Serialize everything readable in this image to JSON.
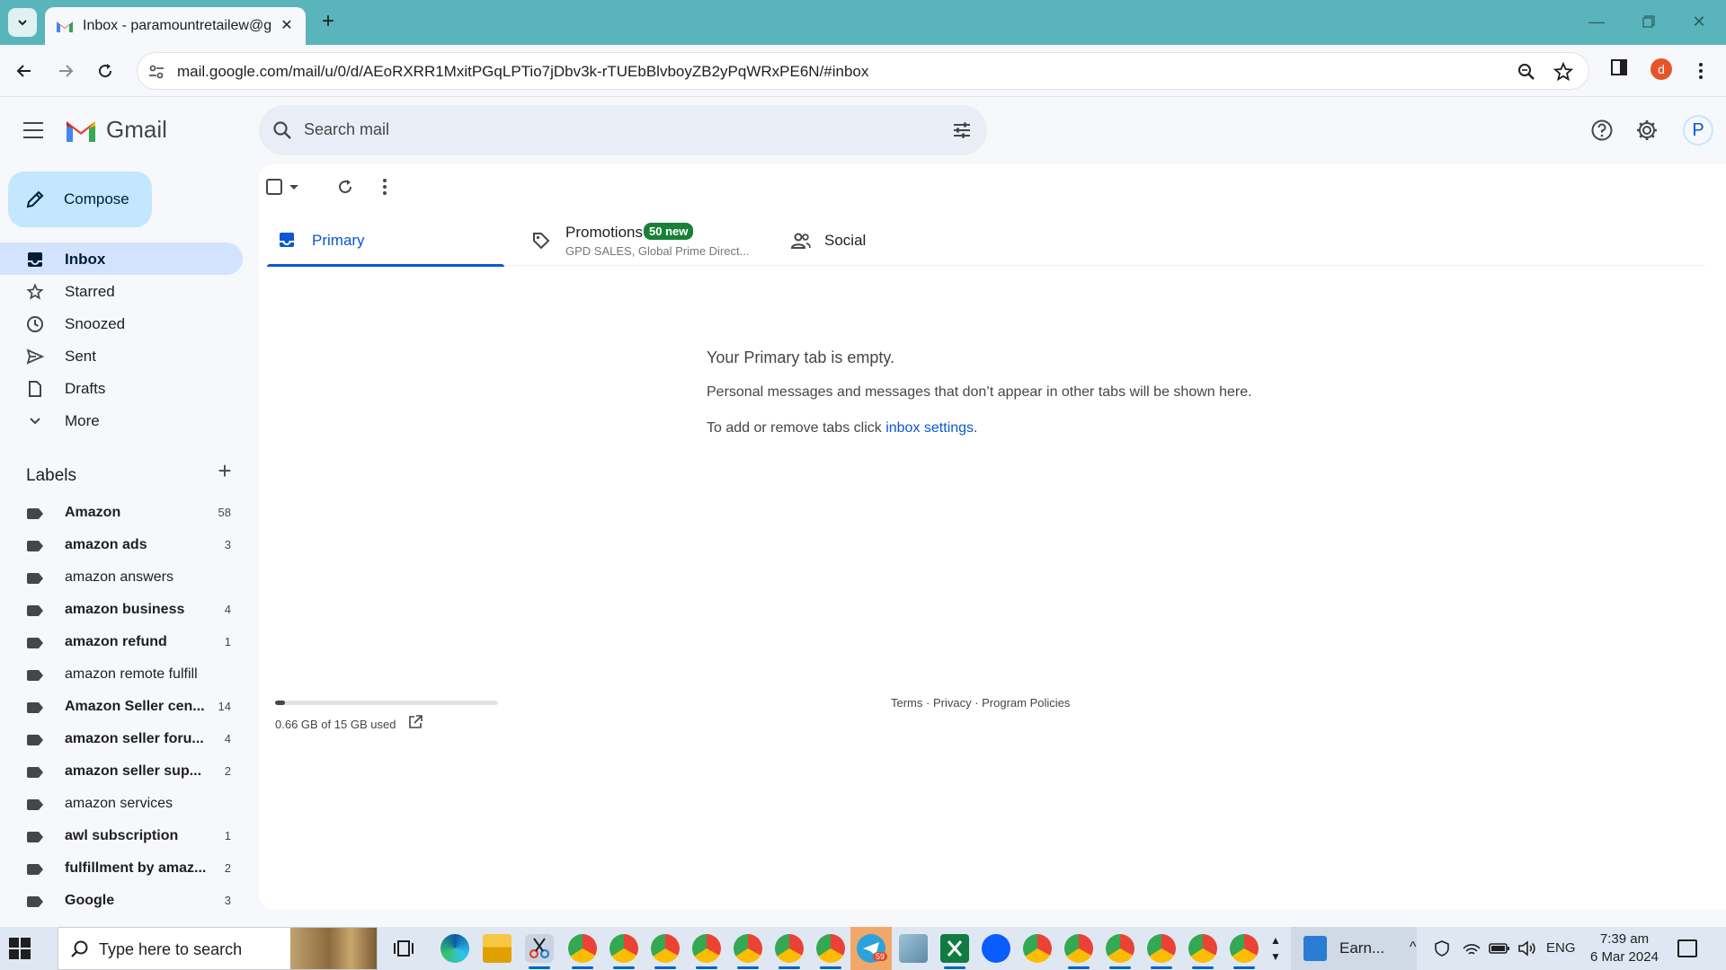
{
  "browser": {
    "tab_title": "Inbox - paramountretailew@gm",
    "url": "mail.google.com/mail/u/0/d/AEoRXRR1MxitPGqLPTio7jDbv3k-rTUEbBlvboyZB2yPqWRxPE6N/#inbox",
    "profile_initial": "d"
  },
  "gmail": {
    "brand": "Gmail",
    "search_placeholder": "Search mail",
    "account_initial": "P",
    "compose_label": "Compose"
  },
  "nav": [
    {
      "label": "Inbox",
      "icon": "inbox-icon"
    },
    {
      "label": "Starred",
      "icon": "star-icon"
    },
    {
      "label": "Snoozed",
      "icon": "clock-icon"
    },
    {
      "label": "Sent",
      "icon": "send-icon"
    },
    {
      "label": "Drafts",
      "icon": "draft-icon"
    },
    {
      "label": "More",
      "icon": "chevron-down-icon"
    }
  ],
  "labels_heading": "Labels",
  "labels": [
    {
      "name": "Amazon",
      "count": "58",
      "bold": true
    },
    {
      "name": "amazon ads",
      "count": "3",
      "bold": true
    },
    {
      "name": "amazon answers",
      "count": "",
      "bold": false
    },
    {
      "name": "amazon business",
      "count": "4",
      "bold": true
    },
    {
      "name": "amazon refund",
      "count": "1",
      "bold": true
    },
    {
      "name": "amazon remote fulfill",
      "count": "",
      "bold": false
    },
    {
      "name": "Amazon Seller cen...",
      "count": "14",
      "bold": true
    },
    {
      "name": "amazon seller foru...",
      "count": "4",
      "bold": true
    },
    {
      "name": "amazon seller sup...",
      "count": "2",
      "bold": true
    },
    {
      "name": "amazon services",
      "count": "",
      "bold": false
    },
    {
      "name": "awl subscription",
      "count": "1",
      "bold": true
    },
    {
      "name": "fulfillment by amaz...",
      "count": "2",
      "bold": true
    },
    {
      "name": "Google",
      "count": "3",
      "bold": true
    }
  ],
  "tabs": {
    "primary": "Primary",
    "promotions": "Promotions",
    "promotions_badge": "50 new",
    "promotions_sub": "GPD SALES, Global Prime Direct...",
    "social": "Social"
  },
  "empty_state": {
    "title": "Your Primary tab is empty.",
    "line1": "Personal messages and messages that don’t appear in other tabs will be shown here.",
    "line2_prefix": "To add or remove tabs click ",
    "line2_link": "inbox settings",
    "line2_suffix": "."
  },
  "storage": {
    "text": "0.66 GB of 15 GB used",
    "fraction": 0.044
  },
  "footer": {
    "terms": "Terms",
    "privacy": "Privacy",
    "policies": "Program Policies",
    "sep": " · "
  },
  "taskbar": {
    "search_placeholder": "Type here to search",
    "earn_label": "Earn...",
    "lang": "ENG",
    "time": "7:39 am",
    "date": "6 Mar 2024",
    "telegram_badge": "59"
  },
  "colors": {
    "accent": "#0b57d0",
    "compose_bg": "#c2e7ff",
    "active_nav": "#d3e3fd",
    "promo_badge": "#188038",
    "tabstrip": "#5ab4bc"
  }
}
